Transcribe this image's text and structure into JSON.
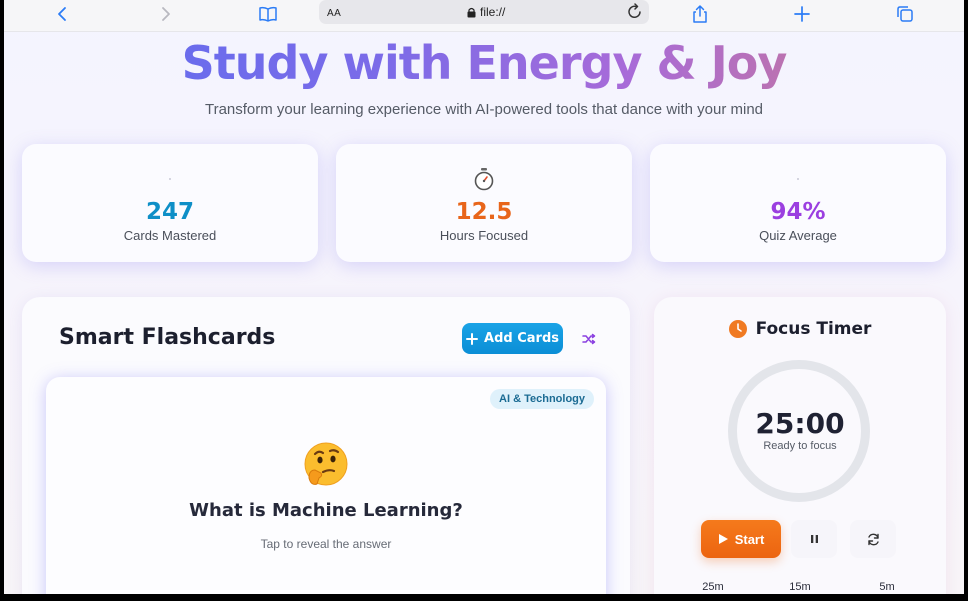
{
  "browser": {
    "text_size_label": "AA",
    "url": "file://"
  },
  "hero": {
    "title": "Study with Energy & Joy",
    "subtitle": "Transform your learning experience with AI-powered tools that dance with your mind"
  },
  "stats": [
    {
      "value": "247",
      "label": "Cards Mastered",
      "color": "#0e8fc7",
      "icon": "dot-icon"
    },
    {
      "value": "12.5",
      "label": "Hours Focused",
      "color": "#e8651a",
      "icon": "stopwatch-icon"
    },
    {
      "value": "94%",
      "label": "Quiz Average",
      "color": "#9b3fe0",
      "icon": "dot-icon"
    }
  ],
  "flashcards": {
    "title": "Smart Flashcards",
    "add_label": "Add Cards",
    "card": {
      "tag": "AI & Technology",
      "question": "What is Machine Learning?",
      "hint": "Tap to reveal the answer"
    }
  },
  "timer": {
    "title": "Focus Timer",
    "time": "25:00",
    "status": "Ready to focus",
    "start_label": "Start",
    "presets": [
      "25m",
      "15m",
      "5m"
    ]
  }
}
